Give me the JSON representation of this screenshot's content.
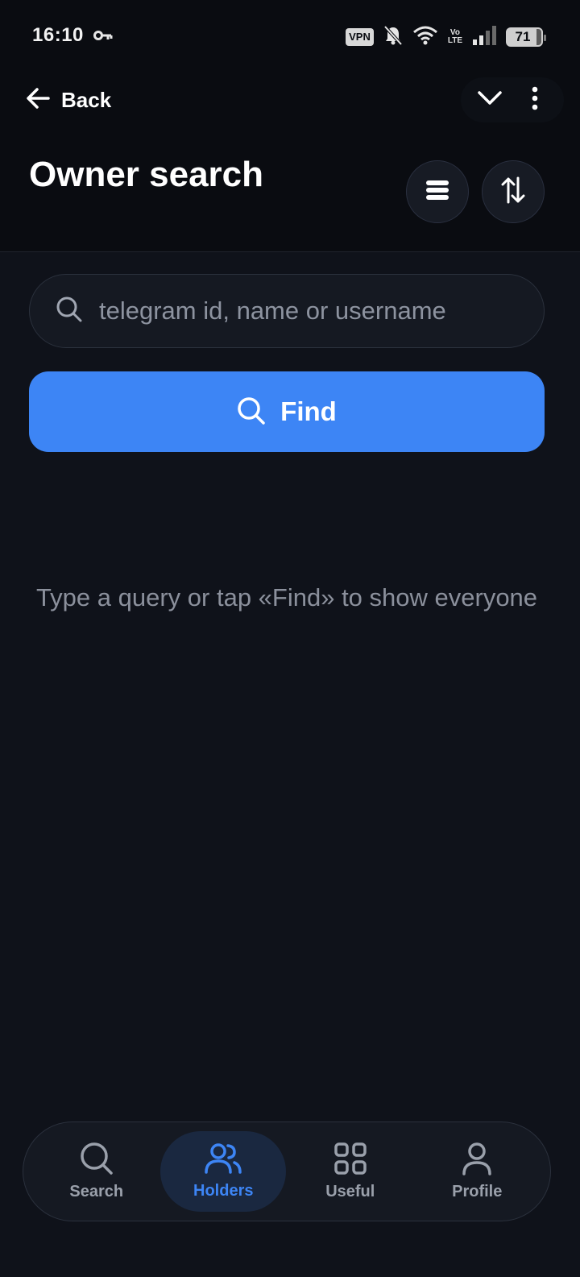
{
  "status_bar": {
    "time": "16:10",
    "vpn": "VPN",
    "volte_top": "Vo",
    "volte_bottom": "LTE",
    "battery": "71",
    "icons": [
      "key-icon",
      "mute-bell-icon",
      "wifi-icon",
      "signal-icon",
      "battery-icon"
    ]
  },
  "header": {
    "back_label": "Back",
    "title": "Owner search"
  },
  "search": {
    "placeholder": "telegram id, name or username",
    "value": ""
  },
  "find_button": {
    "label": "Find"
  },
  "empty_state": {
    "hint": "Type a query or tap «Find» to show everyone"
  },
  "bottom_nav": {
    "items": [
      {
        "label": "Search",
        "icon": "search-icon",
        "active": false
      },
      {
        "label": "Holders",
        "icon": "users-icon",
        "active": true
      },
      {
        "label": "Useful",
        "icon": "grid-icon",
        "active": false
      },
      {
        "label": "Profile",
        "icon": "person-icon",
        "active": false
      }
    ]
  },
  "colors": {
    "accent": "#3d85f5",
    "background": "#0f121a",
    "header_background": "#0a0c11",
    "muted_text": "#8b909c"
  }
}
